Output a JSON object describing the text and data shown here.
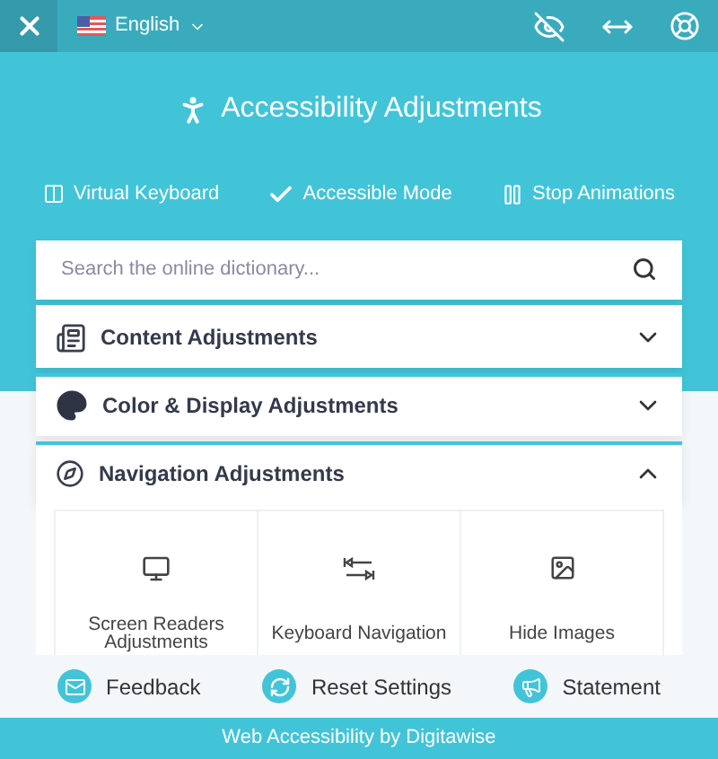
{
  "header": {
    "language": "English"
  },
  "title": "Accessibility Adjustments",
  "quick_actions": [
    {
      "label": "Virtual Keyboard",
      "kind": "keyboard"
    },
    {
      "label": "Accessible Mode",
      "kind": "check"
    },
    {
      "label": "Stop Animations",
      "kind": "pause"
    }
  ],
  "search": {
    "placeholder": "Search the online dictionary..."
  },
  "sections": [
    {
      "title": "Content Adjustments",
      "kind": "content",
      "expanded": false
    },
    {
      "title": "Color & Display Adjustments",
      "kind": "color",
      "expanded": false
    },
    {
      "title": "Navigation Adjustments",
      "kind": "navigation",
      "expanded": true,
      "tiles": [
        {
          "label": "Screen Readers Adjustments",
          "kind": "monitor"
        },
        {
          "label": "Keyboard Navigation",
          "kind": "keys"
        },
        {
          "label": "Hide Images",
          "kind": "image"
        }
      ]
    }
  ],
  "footer_actions": [
    {
      "label": "Feedback",
      "kind": "mail"
    },
    {
      "label": "Reset Settings",
      "kind": "reset"
    },
    {
      "label": "Statement",
      "kind": "megaphone"
    }
  ],
  "banner": "Web Accessibility by Digitawise"
}
